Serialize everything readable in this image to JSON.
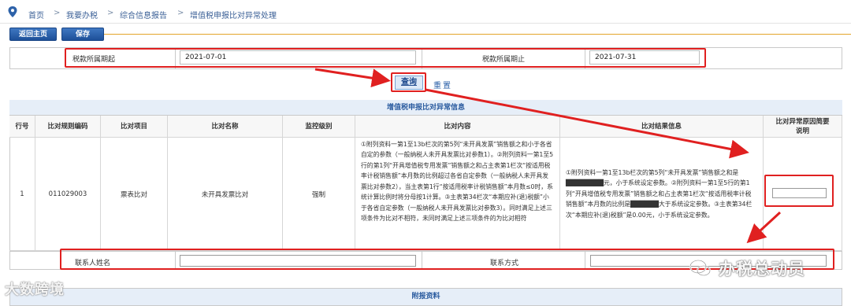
{
  "breadcrumb": {
    "items": [
      "首页",
      "我要办税",
      "综合信息报告",
      "增值税申报比对异常处理"
    ],
    "separator": ">"
  },
  "toolbar": {
    "back_label": "返回主页",
    "save_label": "保存"
  },
  "period": {
    "start_label": "税款所属期起",
    "start_value": "2021-07-01",
    "end_label": "税款所属期止",
    "end_value": "2021-07-31"
  },
  "actions": {
    "query_label": "查询",
    "reset_label": "重置"
  },
  "table": {
    "title": "增值税申报比对异常信息",
    "headers": [
      "行号",
      "比对规则编码",
      "比对项目",
      "比对名称",
      "监控级别",
      "比对内容",
      "比对结果信息",
      "比对异常原因简要说明"
    ],
    "row": {
      "index": "1",
      "rule_code": "011029003",
      "item": "票表比对",
      "name": "未开具发票比对",
      "level": "强制",
      "content": "①附列资料一第1至13b栏次的第5列“未开具发票”销售额之和小于各省自定的参数（一般纳税人未开具发票比对参数1）。②附列资料一第1至5行的第1列“开具增值税专用发票”销售额之和占主表第1栏次“按适用税率计税销售额”本月数的比例超过各省自定参数（一般纳税人未开具发票比对参数2），当主表第1行“按适用税率计税销售额”本月数≤0时，系统计算比例时将分母按1计算。③主表第34栏次“本期应补(退)税额”小于各省自定参数（一般纳税人未开具发票比对参数3）。同时满足上述三项条件为比对不相符，未同时满足上述三项条件的为比对相符",
      "result": "①附列资料一第1至13b栏次的第5列“未开具发票”销售额之和是████████元，小于系统设定参数。②附列资料一第1至5行的第1列“开具增值税专用发票”销售额之和占主表第1栏次“按适用税率计税销售额”本月数的比例是██████大于系统设定参数。③主表第34栏次“本期应补(退)税额”是0.00元，小于系统设定参数。"
    }
  },
  "contact": {
    "name_label": "联系人姓名",
    "phone_label": "联系方式"
  },
  "attachments": {
    "title": "附报资料"
  },
  "watermarks": {
    "left": "大数跨境",
    "right": "办税总动员"
  },
  "colors": {
    "accent_blue": "#1d4f98",
    "highlight_red": "#e02020",
    "link_blue": "#2d62a9",
    "header_bg": "#e6eef8"
  }
}
